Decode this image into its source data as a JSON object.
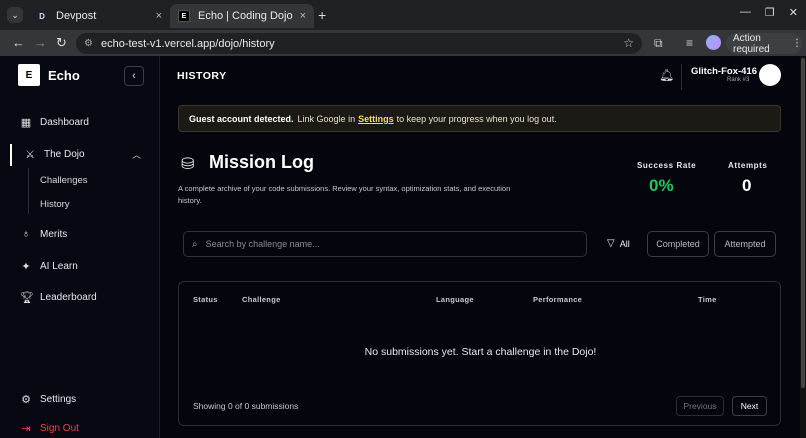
{
  "browser": {
    "tabs": [
      {
        "favicon": "D",
        "title": "Devpost",
        "close": "×"
      },
      {
        "favicon": "E",
        "title": "Echo | Coding Dojo and C",
        "close": "×"
      }
    ],
    "new_tab": "+",
    "url": "echo-test-v1.vercel.app/dojo/history",
    "action_required": "Action required"
  },
  "sidebar": {
    "logo_letter": "E",
    "app_name": "Echo",
    "items": {
      "dashboard": "Dashboard",
      "dojo": "The Dojo",
      "challenges": "Challenges",
      "history": "History",
      "merits": "Merits",
      "ai_learn": "AI Learn",
      "leaderboard": "Leaderboard",
      "settings": "Settings",
      "sign_out": "Sign Out"
    }
  },
  "header": {
    "title": "HISTORY",
    "username": "Glitch-Fox-416",
    "rank": "Rank #3"
  },
  "banner": {
    "bold": "Guest account detected.",
    "before_link": "Link Google in",
    "link": "Settings",
    "after_link": "to keep your progress when you log out."
  },
  "mission": {
    "title": "Mission Log",
    "description": "A complete archive of your code submissions. Review your syntax, optimization stats, and execution history.",
    "success_rate_label": "Success Rate",
    "success_rate_value": "0%",
    "attempts_label": "Attempts",
    "attempts_value": "0"
  },
  "filters": {
    "search_placeholder": "Search by challenge name...",
    "all": "All",
    "completed": "Completed",
    "attempted": "Attempted"
  },
  "table": {
    "headers": [
      "Status",
      "Challenge",
      "Language",
      "Performance",
      "Time"
    ],
    "empty_message": "No submissions yet. Start a challenge in the Dojo!",
    "showing": "Showing 0 of 0 submissions",
    "previous": "Previous",
    "next": "Next"
  },
  "colors": {
    "success": "#22c55e",
    "sign_out": "#ef4444",
    "banner_link": "#f5d76e"
  }
}
